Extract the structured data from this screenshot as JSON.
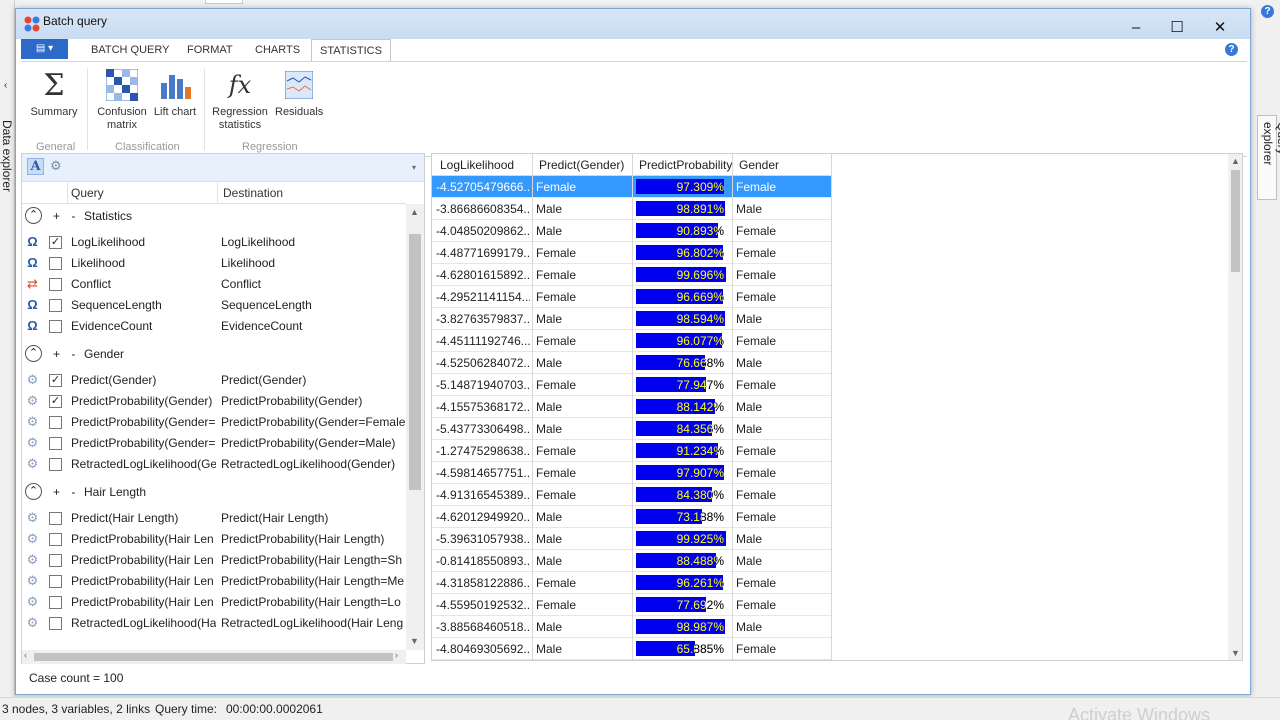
{
  "window": {
    "title": "Batch query",
    "minimize": "–",
    "maximize": "☐",
    "close": "✕"
  },
  "outer": {
    "left_panel": "Data explorer",
    "right_panel": "Query explorer",
    "status_left": "3 nodes, 3 variables, 2 links",
    "status_query_time_label": "Query time:",
    "status_query_time": "00:00:00.0002061",
    "watermark": "Activate Windows"
  },
  "tabs": [
    {
      "label": "BATCH QUERY"
    },
    {
      "label": "FORMAT"
    },
    {
      "label": "CHARTS"
    },
    {
      "label": "STATISTICS",
      "active": true
    }
  ],
  "ribbon": {
    "summary": "Summary",
    "confusion": "Confusion matrix",
    "lift": "Lift chart",
    "regstats": "Regression statistics",
    "residuals": "Residuals",
    "group_general": "General",
    "group_classification": "Classification",
    "group_regression": "Regression"
  },
  "left": {
    "col_query": "Query",
    "col_destination": "Destination",
    "groups": [
      {
        "label": "Statistics",
        "rows": [
          {
            "icon": "omega",
            "checked": true,
            "q": "LogLikelihood",
            "d": "LogLikelihood"
          },
          {
            "icon": "omega",
            "checked": false,
            "q": "Likelihood",
            "d": "Likelihood"
          },
          {
            "icon": "conflict",
            "checked": false,
            "q": "Conflict",
            "d": "Conflict"
          },
          {
            "icon": "omega",
            "checked": false,
            "q": "SequenceLength",
            "d": "SequenceLength"
          },
          {
            "icon": "omega",
            "checked": false,
            "q": "EvidenceCount",
            "d": "EvidenceCount"
          }
        ]
      },
      {
        "label": "Gender",
        "rows": [
          {
            "icon": "gear",
            "checked": true,
            "q": "Predict(Gender)",
            "d": "Predict(Gender)"
          },
          {
            "icon": "gear",
            "checked": true,
            "q": "PredictProbability(Gender)",
            "d": "PredictProbability(Gender)"
          },
          {
            "icon": "gear",
            "checked": false,
            "q": "PredictProbability(Gender=",
            "d": "PredictProbability(Gender=Female"
          },
          {
            "icon": "gear",
            "checked": false,
            "q": "PredictProbability(Gender=",
            "d": "PredictProbability(Gender=Male)"
          },
          {
            "icon": "gear",
            "checked": false,
            "q": "RetractedLogLikelihood(Ge",
            "d": "RetractedLogLikelihood(Gender)"
          }
        ]
      },
      {
        "label": "Hair Length",
        "rows": [
          {
            "icon": "gear",
            "checked": false,
            "q": "Predict(Hair Length)",
            "d": "Predict(Hair Length)"
          },
          {
            "icon": "gear",
            "checked": false,
            "q": "PredictProbability(Hair Len",
            "d": "PredictProbability(Hair Length)"
          },
          {
            "icon": "gear",
            "checked": false,
            "q": "PredictProbability(Hair Len",
            "d": "PredictProbability(Hair Length=Sh"
          },
          {
            "icon": "gear",
            "checked": false,
            "q": "PredictProbability(Hair Len",
            "d": "PredictProbability(Hair Length=Me"
          },
          {
            "icon": "gear",
            "checked": false,
            "q": "PredictProbability(Hair Len",
            "d": "PredictProbability(Hair Length=Lo"
          },
          {
            "icon": "gear",
            "checked": false,
            "q": "RetractedLogLikelihood(Ha",
            "d": "RetractedLogLikelihood(Hair Leng"
          }
        ]
      }
    ]
  },
  "table": {
    "headers": [
      "LogLikelihood",
      "Predict(Gender)",
      "PredictProbability",
      "Gender"
    ],
    "rows": [
      [
        "-4.52705479666...",
        "Female",
        "97.309%",
        "Female"
      ],
      [
        "-3.86686608354...",
        "Male",
        "98.891%",
        "Male"
      ],
      [
        "-4.04850209862...",
        "Male",
        "90.893%",
        "Female"
      ],
      [
        "-4.48771699179...",
        "Female",
        "96.802%",
        "Female"
      ],
      [
        "-4.62801615892...",
        "Female",
        "99.696%",
        "Female"
      ],
      [
        "-4.29521141154...",
        "Female",
        "96.669%",
        "Female"
      ],
      [
        "-3.82763579837...",
        "Male",
        "98.594%",
        "Male"
      ],
      [
        "-4.45111192746...",
        "Female",
        "96.077%",
        "Female"
      ],
      [
        "-4.52506284072...",
        "Male",
        "76.668%",
        "Male"
      ],
      [
        "-5.14871940703...",
        "Female",
        "77.947%",
        "Female"
      ],
      [
        "-4.15575368172...",
        "Male",
        "88.142%",
        "Male"
      ],
      [
        "-5.43773306498...",
        "Male",
        "84.356%",
        "Male"
      ],
      [
        "-1.27475298638...",
        "Female",
        "91.234%",
        "Female"
      ],
      [
        "-4.59814657751...",
        "Female",
        "97.907%",
        "Female"
      ],
      [
        "-4.91316545389...",
        "Female",
        "84.380%",
        "Female"
      ],
      [
        "-4.62012949920...",
        "Male",
        "73.188%",
        "Female"
      ],
      [
        "-5.39631057938...",
        "Male",
        "99.925%",
        "Male"
      ],
      [
        "-0.81418550893...",
        "Male",
        "88.488%",
        "Male"
      ],
      [
        "-4.31858122886...",
        "Female",
        "96.261%",
        "Female"
      ],
      [
        "-4.55950192532...",
        "Female",
        "77.692%",
        "Female"
      ],
      [
        "-3.88568460518...",
        "Male",
        "98.987%",
        "Male"
      ],
      [
        "-4.80469305692...",
        "Male",
        "65.885%",
        "Female"
      ]
    ]
  },
  "case_count": "Case count = 100",
  "colors": {
    "accent": "#3399ff",
    "bar": "#0000ee",
    "title_bg": "#c9dcf2"
  }
}
